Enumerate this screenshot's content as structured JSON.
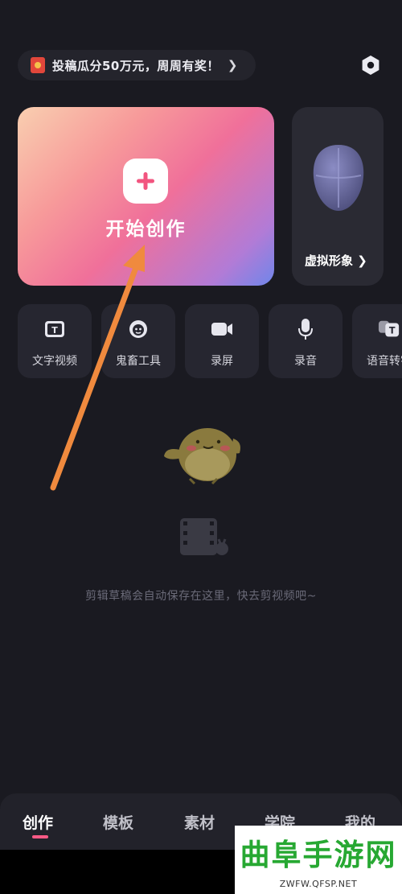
{
  "promo": {
    "text": "投稿瓜分50万元，周周有奖！",
    "chevron": "❯",
    "icon": "red-packet-icon"
  },
  "settings": {
    "icon": "hexagon-settings-icon"
  },
  "create_card": {
    "label": "开始创作",
    "icon": "plus-icon"
  },
  "avatar_card": {
    "label": "虚拟形象",
    "chevron": "❯",
    "icon": "virtual-face-icon"
  },
  "tools": [
    {
      "label": "文字视频",
      "icon": "text-video-icon"
    },
    {
      "label": "鬼畜工具",
      "icon": "face-icon"
    },
    {
      "label": "录屏",
      "icon": "camera-icon"
    },
    {
      "label": "录音",
      "icon": "microphone-icon"
    },
    {
      "label": "语音转字",
      "icon": "speech-to-text-icon"
    }
  ],
  "empty_state": {
    "message": "剪辑草稿会自动保存在这里，快去剪视频吧~"
  },
  "tabs": [
    {
      "label": "创作",
      "active": true
    },
    {
      "label": "模板",
      "active": false
    },
    {
      "label": "素材",
      "active": false
    },
    {
      "label": "学院",
      "active": false
    },
    {
      "label": "我的",
      "active": false
    }
  ],
  "watermark": {
    "title": "曲阜手游网",
    "url": "ZWFW.QFSP.NET"
  },
  "colors": {
    "accent": "#ff5a86",
    "background": "#1a1a21",
    "arrow": "#f08a3e",
    "watermark_green": "#27a832"
  }
}
